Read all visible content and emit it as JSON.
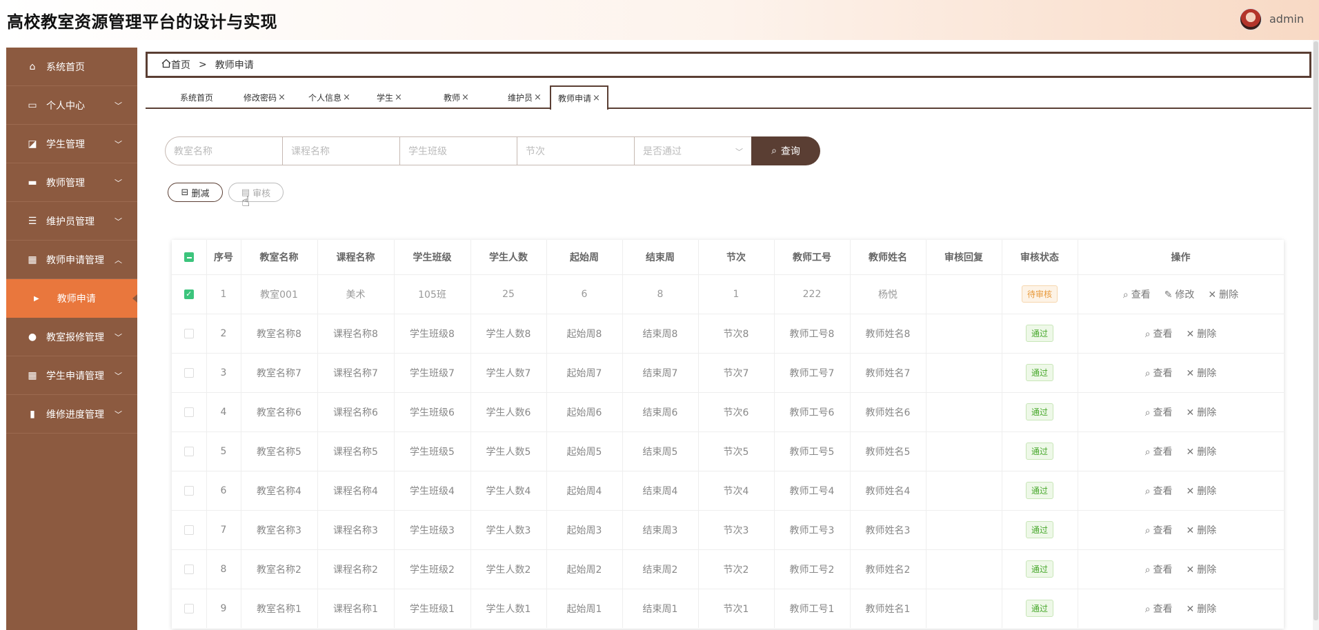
{
  "app": {
    "title": "高校教室资源管理平台的设计与实现",
    "username": "admin"
  },
  "sidebar": {
    "items": [
      {
        "label": "系统首页",
        "icon": "home-icon",
        "has_sub": false
      },
      {
        "label": "个人中心",
        "icon": "wallet-icon",
        "has_sub": true,
        "chev": "﹀"
      },
      {
        "label": "学生管理",
        "icon": "chart-icon",
        "has_sub": true,
        "chev": "﹀"
      },
      {
        "label": "教师管理",
        "icon": "printer-icon",
        "has_sub": true,
        "chev": "﹀"
      },
      {
        "label": "维护员管理",
        "icon": "list-icon",
        "has_sub": true,
        "chev": "﹀"
      },
      {
        "label": "教师申请管理",
        "icon": "grid-icon",
        "has_sub": true,
        "chev": "︿"
      },
      {
        "label": "教室报修管理",
        "icon": "user-icon",
        "has_sub": true,
        "chev": "﹀"
      },
      {
        "label": "学生申请管理",
        "icon": "grid-icon",
        "has_sub": true,
        "chev": "﹀"
      },
      {
        "label": "维修进度管理",
        "icon": "bar-chart-icon",
        "has_sub": true,
        "chev": "﹀"
      }
    ],
    "active_sub": "教师申请"
  },
  "breadcrumb": {
    "home": "首页",
    "sep": ">",
    "current": "教师申请"
  },
  "tabs": [
    {
      "label": "系统首页",
      "closable": false
    },
    {
      "label": "修改密码",
      "closable": true
    },
    {
      "label": "个人信息",
      "closable": true
    },
    {
      "label": "学生",
      "closable": true
    },
    {
      "label": "教师",
      "closable": true
    },
    {
      "label": "维护员",
      "closable": true
    },
    {
      "label": "教师申请",
      "closable": true,
      "active": true
    }
  ],
  "search": {
    "fields": [
      {
        "placeholder": "教室名称"
      },
      {
        "placeholder": "课程名称"
      },
      {
        "placeholder": "学生班级"
      },
      {
        "placeholder": "节次"
      },
      {
        "placeholder": "是否通过",
        "dropdown": true
      }
    ],
    "button": "查询"
  },
  "actions": {
    "delete": "删减",
    "audit": "审核"
  },
  "table": {
    "headers": [
      "序号",
      "教室名称",
      "课程名称",
      "学生班级",
      "学生人数",
      "起始周",
      "结束周",
      "节次",
      "教师工号",
      "教师姓名",
      "审核回复",
      "审核状态",
      "操作"
    ],
    "rows": [
      {
        "checked": true,
        "cells": [
          "1",
          "教室001",
          "美术",
          "105班",
          "25",
          "6",
          "8",
          "1",
          "222",
          "杨悦",
          ""
        ],
        "status": "待审核",
        "status_kind": "pending",
        "ops": [
          "查看",
          "修改",
          "删除"
        ]
      },
      {
        "checked": false,
        "cells": [
          "2",
          "教室名称8",
          "课程名称8",
          "学生班级8",
          "学生人数8",
          "起始周8",
          "结束周8",
          "节次8",
          "教师工号8",
          "教师姓名8",
          ""
        ],
        "status": "通过",
        "status_kind": "pass",
        "ops": [
          "查看",
          "删除"
        ]
      },
      {
        "checked": false,
        "cells": [
          "3",
          "教室名称7",
          "课程名称7",
          "学生班级7",
          "学生人数7",
          "起始周7",
          "结束周7",
          "节次7",
          "教师工号7",
          "教师姓名7",
          ""
        ],
        "status": "通过",
        "status_kind": "pass",
        "ops": [
          "查看",
          "删除"
        ]
      },
      {
        "checked": false,
        "cells": [
          "4",
          "教室名称6",
          "课程名称6",
          "学生班级6",
          "学生人数6",
          "起始周6",
          "结束周6",
          "节次6",
          "教师工号6",
          "教师姓名6",
          ""
        ],
        "status": "通过",
        "status_kind": "pass",
        "ops": [
          "查看",
          "删除"
        ]
      },
      {
        "checked": false,
        "cells": [
          "5",
          "教室名称5",
          "课程名称5",
          "学生班级5",
          "学生人数5",
          "起始周5",
          "结束周5",
          "节次5",
          "教师工号5",
          "教师姓名5",
          ""
        ],
        "status": "通过",
        "status_kind": "pass",
        "ops": [
          "查看",
          "删除"
        ]
      },
      {
        "checked": false,
        "cells": [
          "6",
          "教室名称4",
          "课程名称4",
          "学生班级4",
          "学生人数4",
          "起始周4",
          "结束周4",
          "节次4",
          "教师工号4",
          "教师姓名4",
          ""
        ],
        "status": "通过",
        "status_kind": "pass",
        "ops": [
          "查看",
          "删除"
        ]
      },
      {
        "checked": false,
        "cells": [
          "7",
          "教室名称3",
          "课程名称3",
          "学生班级3",
          "学生人数3",
          "起始周3",
          "结束周3",
          "节次3",
          "教师工号3",
          "教师姓名3",
          ""
        ],
        "status": "通过",
        "status_kind": "pass",
        "ops": [
          "查看",
          "删除"
        ]
      },
      {
        "checked": false,
        "cells": [
          "8",
          "教室名称2",
          "课程名称2",
          "学生班级2",
          "学生人数2",
          "起始周2",
          "结束周2",
          "节次2",
          "教师工号2",
          "教师姓名2",
          ""
        ],
        "status": "通过",
        "status_kind": "pass",
        "ops": [
          "查看",
          "删除"
        ]
      },
      {
        "checked": false,
        "cells": [
          "9",
          "教室名称1",
          "课程名称1",
          "学生班级1",
          "学生人数1",
          "起始周1",
          "结束周1",
          "节次1",
          "教师工号1",
          "教师姓名1",
          ""
        ],
        "status": "通过",
        "status_kind": "pass",
        "ops": [
          "查看",
          "删除"
        ]
      }
    ]
  },
  "colors": {
    "sidebar": "#8c5a40",
    "accent": "#e9773d",
    "dark": "#5a3e33",
    "pass": "#47a82b",
    "pending": "#e89a3c"
  }
}
